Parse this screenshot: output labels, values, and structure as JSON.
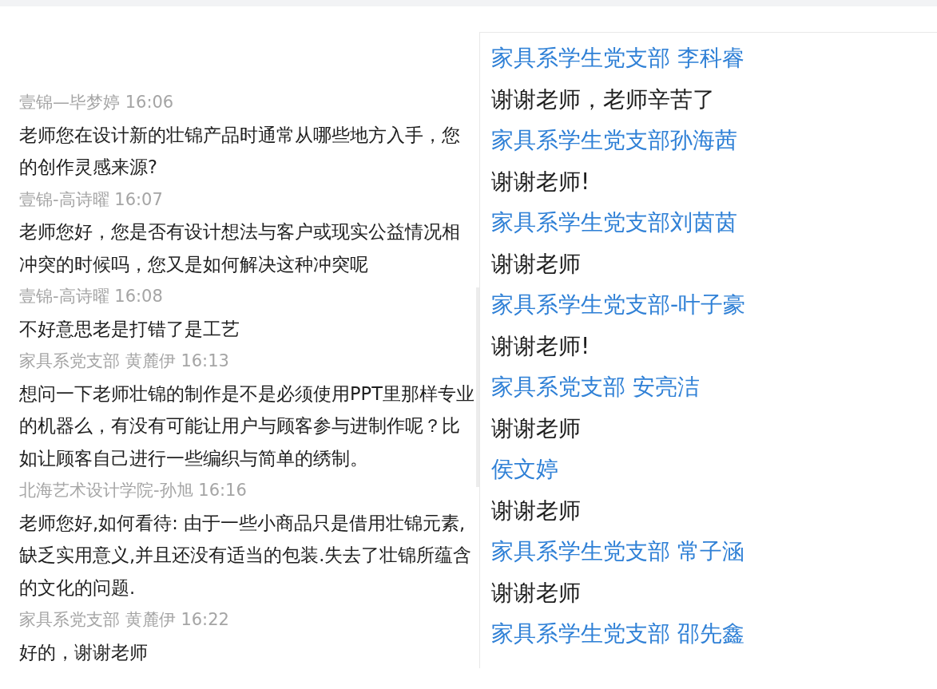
{
  "left_chat": {
    "messages": [
      {
        "sender": "壹锦—毕梦婷",
        "time": "16:06",
        "text": "老师您在设计新的壮锦产品时通常从哪些地方入手，您的创作灵感来源?"
      },
      {
        "sender": "壹锦-高诗曜",
        "time": "16:07",
        "text": "老师您好，您是否有设计想法与客户或现实公益情况相冲突的时候吗，您又是如何解决这种冲突呢"
      },
      {
        "sender": "壹锦-高诗曜",
        "time": "16:08",
        "text": "不好意思老是打错了是工艺"
      },
      {
        "sender": "家具系党支部 黄麓伊",
        "time": "16:13",
        "text": "想问一下老师壮锦的制作是不是必须使用PPT里那样专业的机器么，有没有可能让用户与顾客参与进制作呢？比如让顾客自己进行一些编织与简单的绣制。"
      },
      {
        "sender": "北海艺术设计学院-孙旭",
        "time": "16:16",
        "text": "老师您好,如何看待: 由于一些小商品只是借用壮锦元素,缺乏实用意义,并且还没有适当的包装.失去了壮锦所蕴含的文化的问题."
      },
      {
        "sender": "家具系党支部 黄麓伊",
        "time": "16:22",
        "text": "好的，谢谢老师"
      }
    ]
  },
  "right_chat": {
    "messages": [
      {
        "sender": "家具系学生党支部 李科睿",
        "text": "谢谢老师，老师辛苦了"
      },
      {
        "sender": "家具系学生党支部孙海茜",
        "text": "谢谢老师!"
      },
      {
        "sender": "家具系学生党支部刘茵茵",
        "text": "谢谢老师"
      },
      {
        "sender": "家具系学生党支部-叶子豪",
        "text": "谢谢老师!"
      },
      {
        "sender": "家具系党支部 安亮洁",
        "text": "谢谢老师"
      },
      {
        "sender": "侯文婷",
        "text": "谢谢老师"
      },
      {
        "sender": "家具系学生党支部 常子涵",
        "text": "谢谢老师"
      },
      {
        "sender": "家具系学生党支部 邵先鑫"
      }
    ]
  }
}
